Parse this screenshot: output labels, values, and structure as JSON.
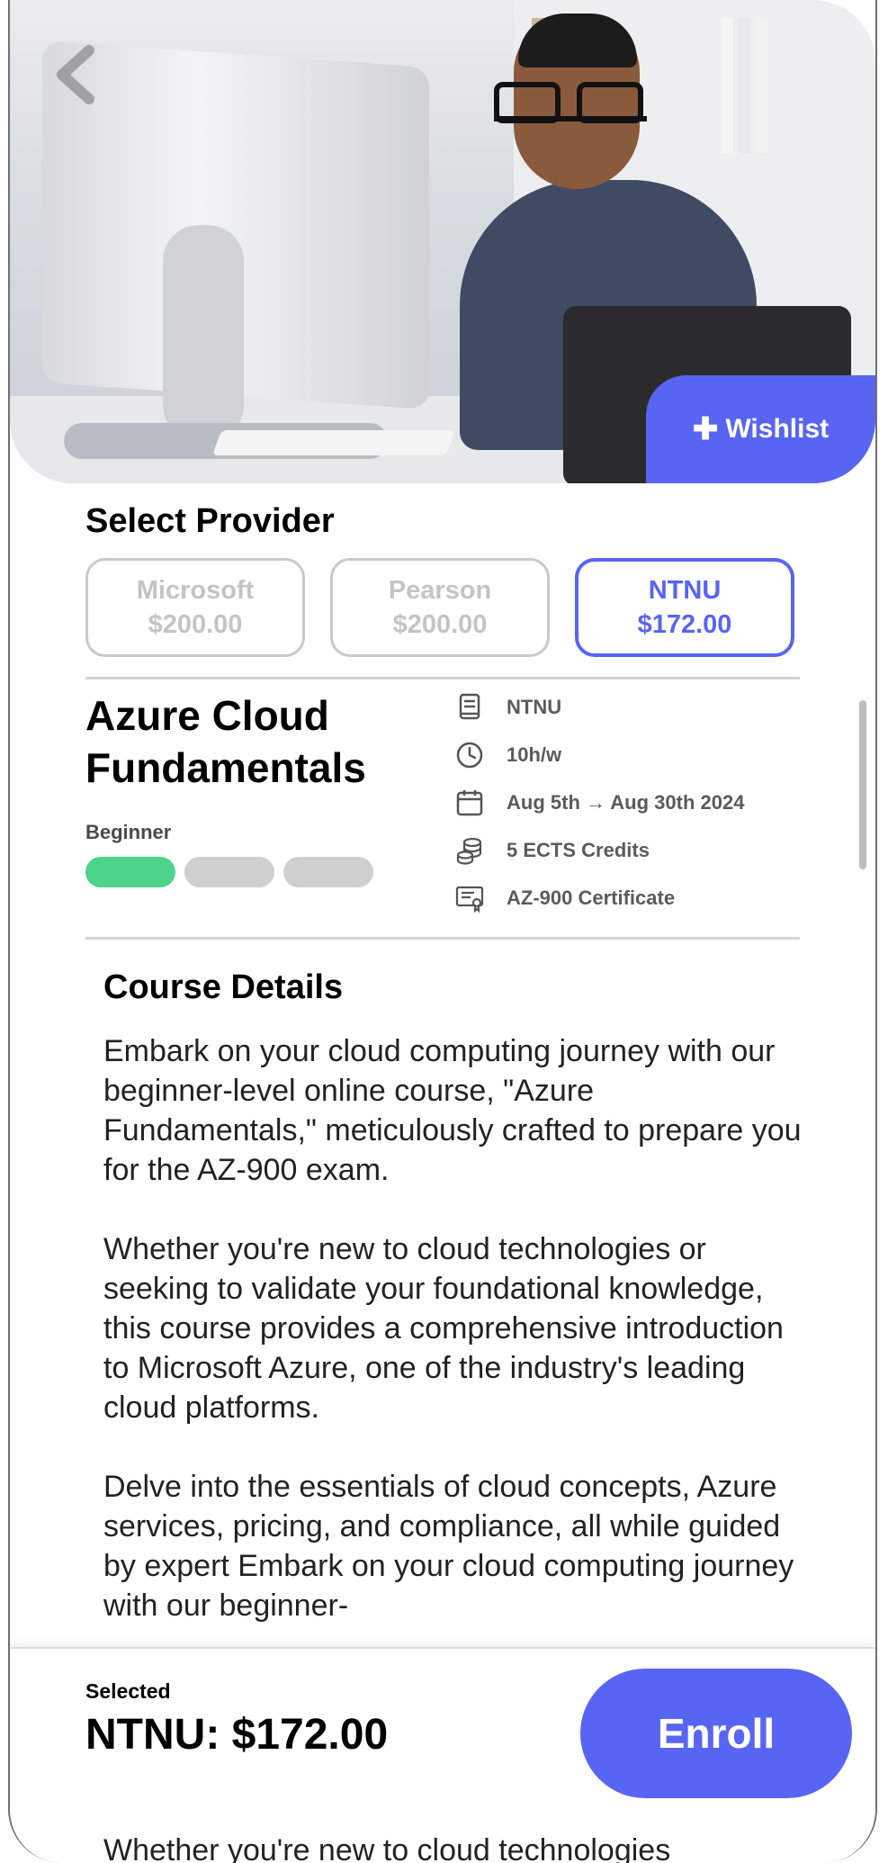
{
  "hero": {
    "wishlist_label": "Wishlist"
  },
  "provider": {
    "title": "Select Provider",
    "options": [
      {
        "name": "Microsoft",
        "price": "$200.00",
        "selected": false
      },
      {
        "name": "Pearson",
        "price": "$200.00",
        "selected": false
      },
      {
        "name": "NTNU",
        "price": "$172.00",
        "selected": true
      }
    ]
  },
  "course": {
    "title_line1": "Azure Cloud",
    "title_line2": "Fundamentals",
    "level": "Beginner",
    "level_value": 1,
    "level_max": 3,
    "info": [
      {
        "icon": "book-icon",
        "text": "NTNU"
      },
      {
        "icon": "clock-icon",
        "text": "10h/w"
      },
      {
        "icon": "calendar-icon",
        "text": "Aug 5th → Aug 30th 2024"
      },
      {
        "icon": "coins-icon",
        "text": "5 ECTS Credits"
      },
      {
        "icon": "certificate-icon",
        "text": "AZ-900 Certificate"
      }
    ]
  },
  "details": {
    "title": "Course Details",
    "paragraphs": [
      "Embark on your cloud computing journey with our beginner-level online course, \"Azure Fundamentals,\" meticulously crafted to prepare you for the AZ-900 exam.",
      "Whether you're new to cloud technologies or seeking to validate your foundational knowledge, this course provides a comprehensive introduction to Microsoft Azure, one of the industry's leading cloud platforms.",
      "Delve into the essentials of cloud concepts, Azure services, pricing, and compliance, all while guided by expert Embark on your cloud computing journey with our beginner-"
    ],
    "peek_text": "Whether you're new to cloud technologies"
  },
  "footer": {
    "selected_label": "Selected",
    "selected_value": "NTNU: $172.00",
    "enroll_label": "Enroll"
  },
  "colors": {
    "accent": "#5865f2",
    "level_on": "#4cd38c",
    "level_off": "#cfcfcf"
  }
}
